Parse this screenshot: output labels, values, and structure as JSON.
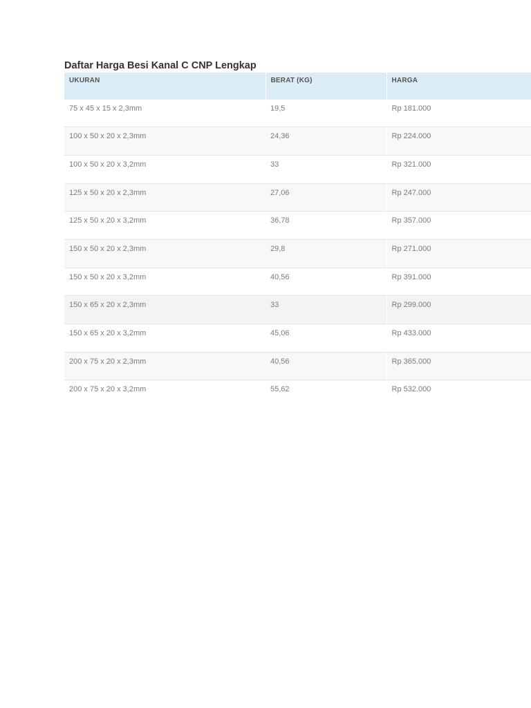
{
  "page": {
    "title": "Daftar Harga Besi Kanal C CNP Lengkap"
  },
  "table": {
    "headers": [
      "UKURAN",
      "BERAT (KG)",
      "HARGA"
    ],
    "rows": [
      [
        "75 x 45 x 15 x 2,3mm",
        "19,5",
        "Rp 181.000"
      ],
      [
        "100 x 50 x 20 x 2,3mm",
        "24,36",
        "Rp 224.000"
      ],
      [
        "100 x 50 x 20 x 3,2mm",
        "33",
        "Rp 321.000"
      ],
      [
        "125 x 50 x 20 x 2,3mm",
        "27,06",
        "Rp 247.000"
      ],
      [
        "125 x 50 x 20 x 3,2mm",
        "36,78",
        "Rp 357.000"
      ],
      [
        "150 x 50 x 20 x 2,3mm",
        "29,8",
        "Rp 271.000"
      ],
      [
        "150 x 50 x 20 x 3,2mm",
        "40,56",
        "Rp 391.000"
      ],
      [
        "150 x 65 x 20 x 2,3mm",
        "33",
        "Rp 299.000"
      ],
      [
        "150 x 65 x 20 x 3,2mm",
        "45,06",
        "Rp 433.000"
      ],
      [
        "200 x 75 x 20 x 2,3mm",
        "40,56",
        "Rp 365.000"
      ],
      [
        "200 x 75 x 20 x 3,2mm",
        "55,62",
        "Rp 532.000"
      ]
    ]
  },
  "colors": {
    "header_bg": "#daecf6",
    "row_alt_bg": "#f8f8f8",
    "row_highlight_bg": "#f3f3f3",
    "title_text": "#333333",
    "cell_text": "#7a7a7a"
  }
}
